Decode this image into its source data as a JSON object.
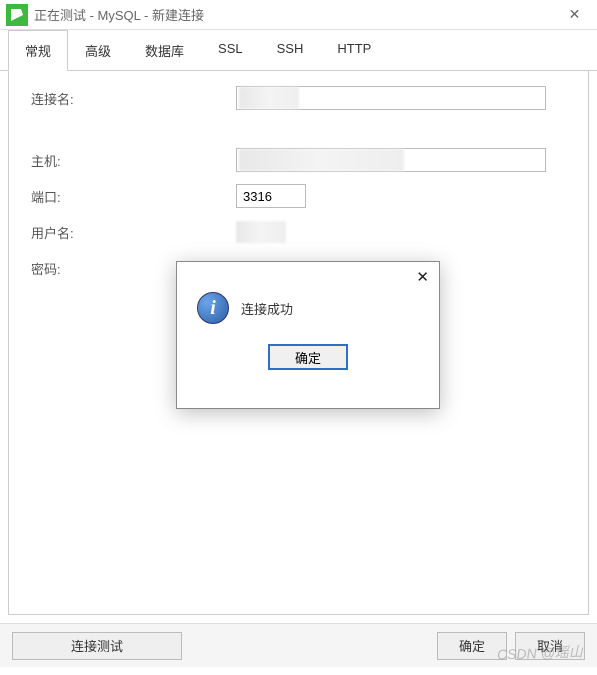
{
  "titlebar": {
    "title": "正在测试 - MySQL - 新建连接"
  },
  "tabs": {
    "items": [
      {
        "label": "常规"
      },
      {
        "label": "高级"
      },
      {
        "label": "数据库"
      },
      {
        "label": "SSL"
      },
      {
        "label": "SSH"
      },
      {
        "label": "HTTP"
      }
    ]
  },
  "form": {
    "connection_name_label": "连接名:",
    "host_label": "主机:",
    "port_label": "端口:",
    "port_value": "3316",
    "username_label": "用户名:",
    "password_label": "密码:",
    "password_value": "●●●●●"
  },
  "buttons": {
    "test": "连接测试",
    "ok": "确定",
    "cancel": "取消"
  },
  "modal": {
    "message": "连接成功",
    "ok": "确定"
  },
  "watermark": "CSDN @瑶山"
}
